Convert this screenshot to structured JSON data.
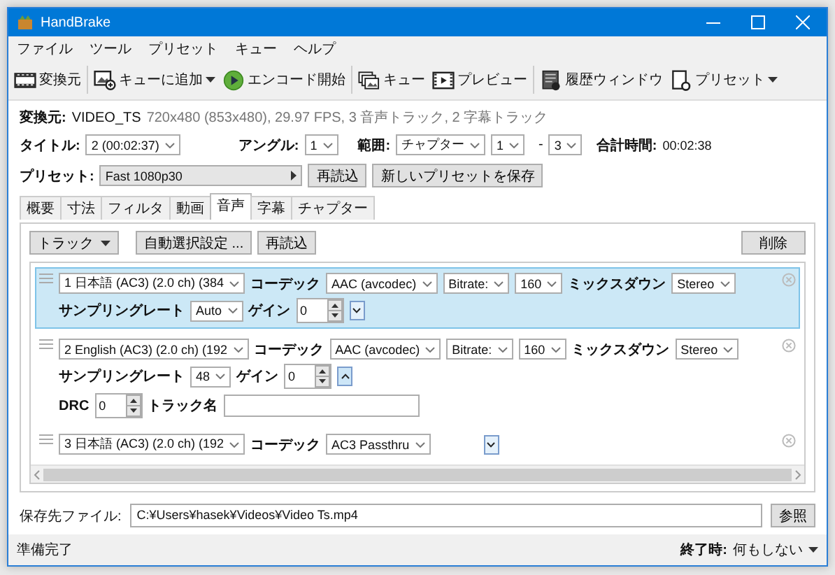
{
  "window": {
    "title": "HandBrake"
  },
  "menu": [
    "ファイル",
    "ツール",
    "プリセット",
    "キュー",
    "ヘルプ"
  ],
  "toolbar": [
    {
      "kind": "source",
      "label": "変換元",
      "dropdown": false
    },
    {
      "kind": "add_queue",
      "label": "キューに追加",
      "dropdown": true
    },
    {
      "kind": "start",
      "label": "エンコード開始",
      "dropdown": false
    },
    {
      "kind": "queue",
      "label": "キュー",
      "dropdown": false
    },
    {
      "kind": "preview",
      "label": "プレビュー",
      "dropdown": false
    },
    {
      "kind": "activity",
      "label": "履歴ウィンドウ",
      "dropdown": false
    },
    {
      "kind": "presets",
      "label": "プリセット",
      "dropdown": true
    }
  ],
  "source": {
    "label": "変換元:",
    "name": "VIDEO_TS",
    "info": "720x480 (853x480), 29.97 FPS, 3 音声トラック, 2 字幕トラック"
  },
  "title_row": {
    "title_label": "タイトル:",
    "title": "2 (00:02:37)",
    "angle_label": "アングル:",
    "angle": "1",
    "range_label": "範囲:",
    "range_type": "チャプター",
    "range_start": "1",
    "range_sep": "-",
    "range_end": "3",
    "duration_label": "合計時間:",
    "duration": "00:02:38"
  },
  "preset_row": {
    "label": "プリセット:",
    "preset": "Fast 1080p30",
    "reload": "再読込",
    "save": "新しいプリセットを保存"
  },
  "tabs": [
    {
      "label": "概要",
      "selected": false
    },
    {
      "label": "寸法",
      "selected": false
    },
    {
      "label": "フィルタ",
      "selected": false
    },
    {
      "label": "動画",
      "selected": false
    },
    {
      "label": "音声",
      "selected": true
    },
    {
      "label": "字幕",
      "selected": false
    },
    {
      "label": "チャプター",
      "selected": false
    }
  ],
  "audio": {
    "track_menu": "トラック",
    "auto_select": "自動選択設定 ...",
    "reload": "再読込",
    "remove": "削除",
    "tracks": [
      {
        "kind": "encode",
        "selected": true,
        "expanded": false,
        "source": "1 日本語 (AC3) (2.0 ch) (384",
        "codec_label": "コーデック",
        "codec": "AAC (avcodec)",
        "bitrate_mode": "Bitrate:",
        "bitrate": "160",
        "mixdown_label": "ミックスダウン",
        "mixdown": "Stereo",
        "samplerate_label": "サンプリングレート",
        "samplerate": "Auto",
        "gain_label": "ゲイン",
        "gain": "0"
      },
      {
        "kind": "encode",
        "selected": false,
        "expanded": true,
        "source": "2 English (AC3) (2.0 ch) (192",
        "codec_label": "コーデック",
        "codec": "AAC (avcodec)",
        "bitrate_mode": "Bitrate:",
        "bitrate": "160",
        "mixdown_label": "ミックスダウン",
        "mixdown": "Stereo",
        "samplerate_label": "サンプリングレート",
        "samplerate": "48",
        "gain_label": "ゲイン",
        "gain": "0",
        "drc_label": "DRC",
        "drc": "0",
        "name_label": "トラック名"
      },
      {
        "kind": "passthru",
        "selected": false,
        "expanded": false,
        "source": "3 日本語 (AC3) (2.0 ch) (192",
        "codec_label": "コーデック",
        "codec": "AC3 Passthru"
      }
    ]
  },
  "destination": {
    "label": "保存先ファイル:",
    "path": "C:¥Users¥hasek¥Videos¥Video Ts.mp4",
    "browse": "参照"
  },
  "status_bar": {
    "status": "準備完了",
    "when_done_label": "終了時:",
    "when_done": "何もしない"
  }
}
